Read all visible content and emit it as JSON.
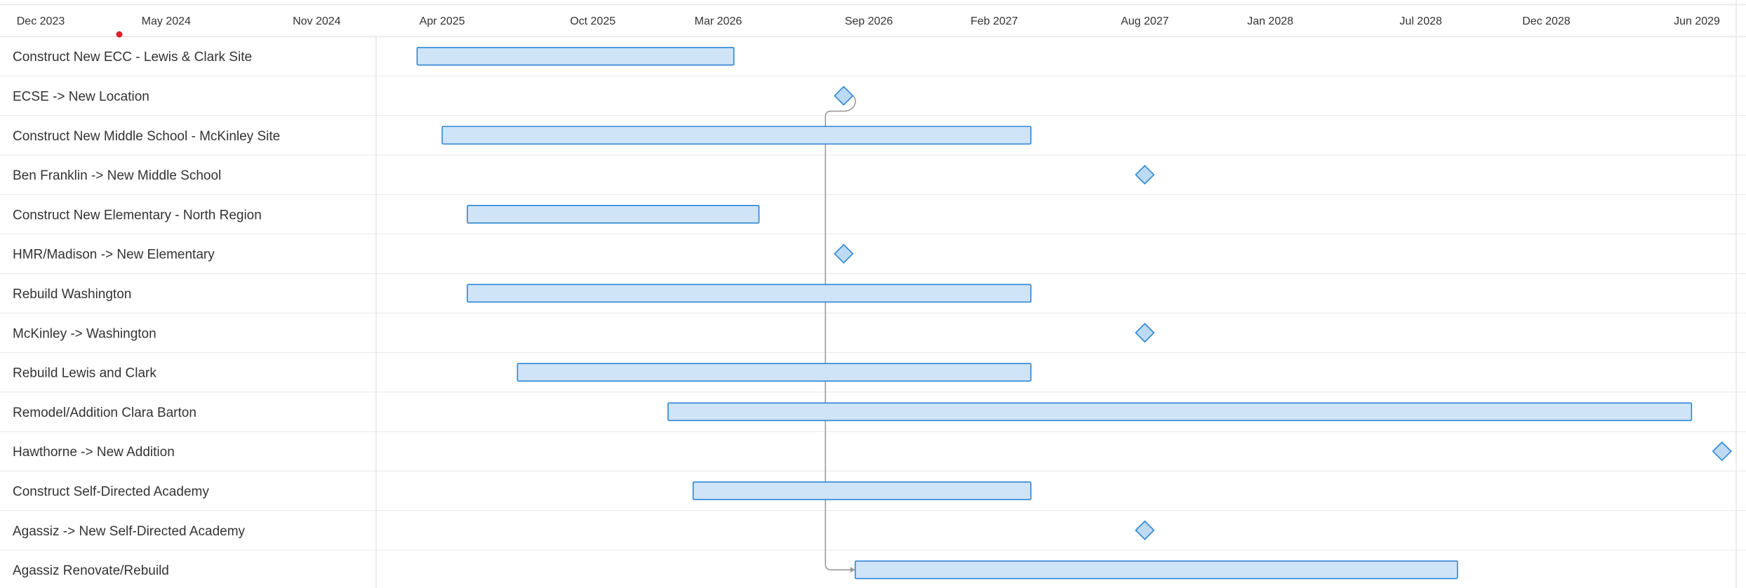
{
  "chart_data": {
    "type": "gantt",
    "timeline_ticks": [
      "Dec 2023",
      "May 2024",
      "Nov 2024",
      "Apr 2025",
      "Oct 2025",
      "Mar 2026",
      "Sep 2026",
      "Feb 2027",
      "Aug 2027",
      "Jan 2028",
      "Jul 2028",
      "Dec 2028",
      "Jun 2029"
    ],
    "today_marker": "2024-03",
    "tasks": [
      {
        "name": "Construct New ECC - Lewis & Clark Site",
        "kind": "bar",
        "start": "2025-03-01",
        "end": "2026-03-20"
      },
      {
        "name": "ECSE -> New Location",
        "kind": "milestone",
        "date": "2026-08-01"
      },
      {
        "name": "Construct New Middle School - McKinley Site",
        "kind": "bar",
        "start": "2025-04-01",
        "end": "2027-03-15"
      },
      {
        "name": "Ben Franklin -> New Middle School",
        "kind": "milestone",
        "date": "2027-08-01"
      },
      {
        "name": "Construct New Elementary - North Region",
        "kind": "bar",
        "start": "2025-05-01",
        "end": "2026-04-20"
      },
      {
        "name": "HMR/Madison -> New Elementary",
        "kind": "milestone",
        "date": "2026-08-01"
      },
      {
        "name": "Rebuild Washington",
        "kind": "bar",
        "start": "2025-05-01",
        "end": "2027-03-15"
      },
      {
        "name": "McKinley -> Washington",
        "kind": "milestone",
        "date": "2027-08-01"
      },
      {
        "name": "Rebuild Lewis and Clark",
        "kind": "bar",
        "start": "2025-07-01",
        "end": "2027-03-15"
      },
      {
        "name": "Remodel/Addition Clara Barton",
        "kind": "bar",
        "start": "2026-01-01",
        "end": "2029-05-25"
      },
      {
        "name": "Hawthorne -> New Addition",
        "kind": "milestone",
        "date": "2029-07-01"
      },
      {
        "name": "Construct Self-Directed Academy",
        "kind": "bar",
        "start": "2026-02-01",
        "end": "2027-03-15"
      },
      {
        "name": "Agassiz -> New Self-Directed Academy",
        "kind": "milestone",
        "date": "2027-08-01"
      },
      {
        "name": "Agassiz Renovate/Rebuild",
        "kind": "bar",
        "start": "2026-08-15",
        "end": "2028-08-15"
      }
    ],
    "dependencies": [
      {
        "from": "ECSE -> New Location",
        "to": "Agassiz Renovate/Rebuild"
      }
    ],
    "colors": {
      "bar_fill": "#cfe4f6",
      "bar_stroke": "#2e86d4",
      "milestone_fill": "#bcdaf3",
      "milestone_stroke": "#2e86d4",
      "grid": "#e6e6e6",
      "dependency": "#9a9a9a",
      "today": "#d9232d",
      "text": "#333333"
    }
  }
}
